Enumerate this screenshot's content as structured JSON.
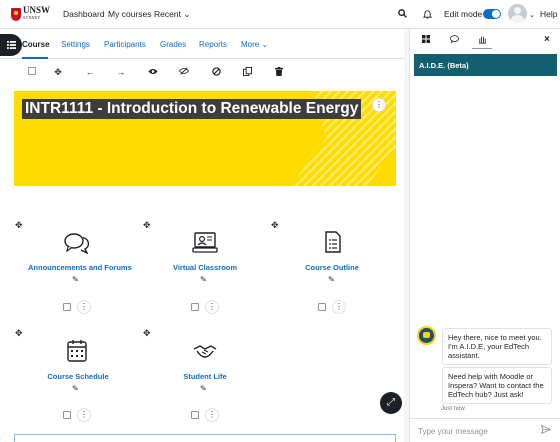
{
  "navbar": {
    "logo_text": "UNSW",
    "logo_sub": "SYDNEY",
    "links": [
      "Dashboard",
      "My courses",
      "Recent"
    ],
    "recent_caret": "⌄",
    "edit_mode_label": "Edit mode",
    "edit_mode_on": true,
    "help_label": "Help",
    "avatar_caret": "⌄"
  },
  "subnav": {
    "tabs": [
      "Course",
      "Settings",
      "Participants",
      "Grades",
      "Reports",
      "More"
    ],
    "more_caret": "⌄",
    "active_tab": "Course"
  },
  "toolbar": {
    "icons": [
      "select-checkbox",
      "move-icon",
      "arrow-left-icon",
      "arrow-right-icon",
      "show-icon",
      "hide-icon",
      "availability-icon",
      "duplicate-icon",
      "delete-icon"
    ]
  },
  "banner": {
    "title": "INTR1111 - Introduction to Renewable Energy",
    "kebab": "⋮",
    "bg_color": "#ffdc00"
  },
  "tiles": [
    {
      "label": "Announcements and Forums",
      "icon": "forum-icon"
    },
    {
      "label": "Virtual Classroom",
      "icon": "virtual-classroom-icon"
    },
    {
      "label": "Course Outline",
      "icon": "document-icon"
    },
    {
      "label": "Course Schedule",
      "icon": "calendar-icon"
    },
    {
      "label": "Student Life",
      "icon": "handshake-icon"
    }
  ],
  "drawer": {
    "header": "A.I.D.E. (Beta)",
    "header_color": "#12606f",
    "messages": [
      "Hey there, nice to meet you. I'm A.I.D.E, your EdTech assistant.",
      "Need help with Moodle or Inspera? Want to contact the EdTech hub? Just ask!"
    ],
    "timestamp": "Just now",
    "input_placeholder": "Type your message"
  },
  "accent_color": "#0f6cbf"
}
